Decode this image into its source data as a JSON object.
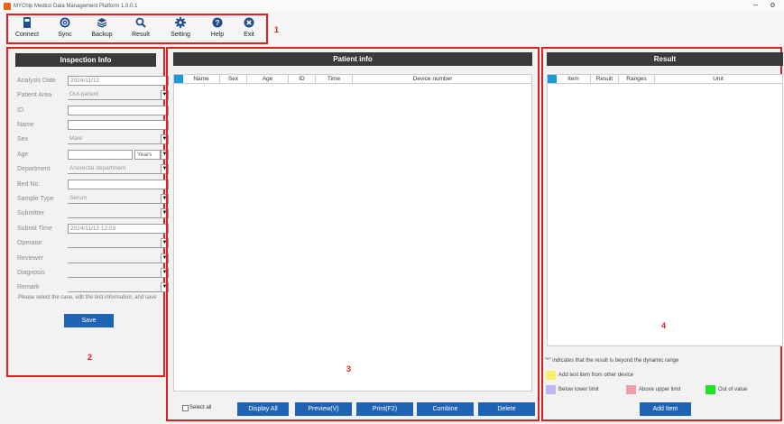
{
  "window": {
    "title": "MYChip Medico Data Management Platform 1.0.0.1",
    "minimize": "–",
    "maximize": "o"
  },
  "toolbar": {
    "buttons": [
      {
        "label": "Connect",
        "icon": "monitor-icon"
      },
      {
        "label": "Sync",
        "icon": "sync-icon"
      },
      {
        "label": "Backup",
        "icon": "layers-icon"
      },
      {
        "label": "Result",
        "icon": "search-icon"
      },
      {
        "label": "Setting",
        "icon": "gear-icon"
      },
      {
        "label": "Help",
        "icon": "help-icon"
      },
      {
        "label": "Exit",
        "icon": "close-circle-icon"
      }
    ]
  },
  "annotations": {
    "n1": "1",
    "n2": "2",
    "n3": "3",
    "n4": "4"
  },
  "inspection": {
    "title": "Inspection Info",
    "fields": {
      "analysis_date": {
        "label": "Analysis Date",
        "value": "2024/11/12"
      },
      "patient_area": {
        "label": "Patient Area",
        "value": "Out-patient"
      },
      "id": {
        "label": "ID",
        "value": ""
      },
      "name": {
        "label": "Name",
        "value": ""
      },
      "sex": {
        "label": "Sex",
        "value": "Male"
      },
      "age": {
        "label": "Age",
        "value": "",
        "unit": "Years"
      },
      "department": {
        "label": "Department",
        "value": "Anorectal department"
      },
      "bed_no": {
        "label": "Bed No.",
        "value": ""
      },
      "sample_type": {
        "label": "Sample Type",
        "value": "Serum"
      },
      "submitter": {
        "label": "Submitter",
        "value": ""
      },
      "submit_time": {
        "label": "Submit Time",
        "value": "2024/11/12 12:03"
      },
      "operator": {
        "label": "Operator",
        "value": ""
      },
      "reviewer": {
        "label": "Reviewer",
        "value": ""
      },
      "diagnosis": {
        "label": "Diagnosis",
        "value": ""
      },
      "remark": {
        "label": "Remark",
        "value": ""
      }
    },
    "hint": "Please select the case, edit the test information, and save",
    "save_label": "Save"
  },
  "patient": {
    "title": "Patient info",
    "columns": [
      "Name",
      "Sex",
      "Age",
      "ID",
      "Time",
      "Device number"
    ],
    "select_all": "Select all",
    "buttons": {
      "display_all": "Display All",
      "preview": "Preview(V)",
      "print": "Print(F2)",
      "combine": "Combine",
      "delete": "Delete"
    }
  },
  "result": {
    "title": "Result",
    "columns": [
      "Item",
      "Result",
      "Ranges",
      "Unit"
    ],
    "note_dynamic": "\"*\" indicates that the result is beyond the dynamic range",
    "legend": {
      "other_device": "Add test item from other device",
      "below": "Below lower limit",
      "above": "Above upper limit",
      "out": "Out of value"
    },
    "colors": {
      "other_device": "#f5f064",
      "below": "#b9b9f0",
      "above": "#f29aa6",
      "out": "#22e022",
      "header_corner": "#1a9ad6",
      "button": "#1f63b5"
    },
    "add_item": "Add Item"
  }
}
